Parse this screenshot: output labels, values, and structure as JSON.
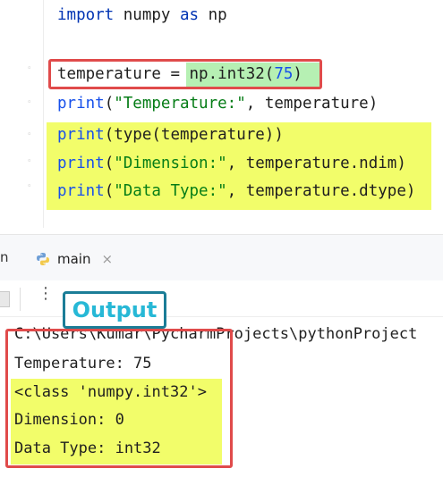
{
  "editor": {
    "lines": {
      "import_kw": "import",
      "import_rest": " numpy ",
      "as_kw": "as",
      "as_rest": " np",
      "temp_var": "temperature",
      "temp_eq": " = ",
      "temp_call": "np.int32(",
      "temp_num": "75",
      "temp_close": ")",
      "p1_fn": "print",
      "p1_open": "(",
      "p1_str": "\"Temperature:\"",
      "p1_rest": ", temperature)",
      "p2_fn": "print",
      "p2_rest": "(type(temperature))",
      "p3_fn": "print",
      "p3_open": "(",
      "p3_str": "\"Dimension:\"",
      "p3_rest": ", temperature.ndim)",
      "p4_fn": "print",
      "p4_open": "(",
      "p4_str": "\"Data Type:\"",
      "p4_rest": ", temperature.dtype)"
    }
  },
  "run_window": {
    "left_tab_stub": "n",
    "tab_label": "main",
    "close_glyph": "×",
    "kebab_glyph": "⋮",
    "output_badge": "Output"
  },
  "console": {
    "path": "C:\\Users\\Kumar\\PycharmProjects\\pythonProject",
    "lines": [
      "Temperature: 75",
      "<class 'numpy.int32'>",
      "Dimension: 0",
      "Data Type: int32"
    ]
  },
  "colors": {
    "highlight_yellow": "#f2fd6a",
    "highlight_green": "#b6f0b3",
    "annotation_red": "#e04b4b",
    "badge_border": "#1b7d97",
    "badge_text": "#27b8d6"
  }
}
